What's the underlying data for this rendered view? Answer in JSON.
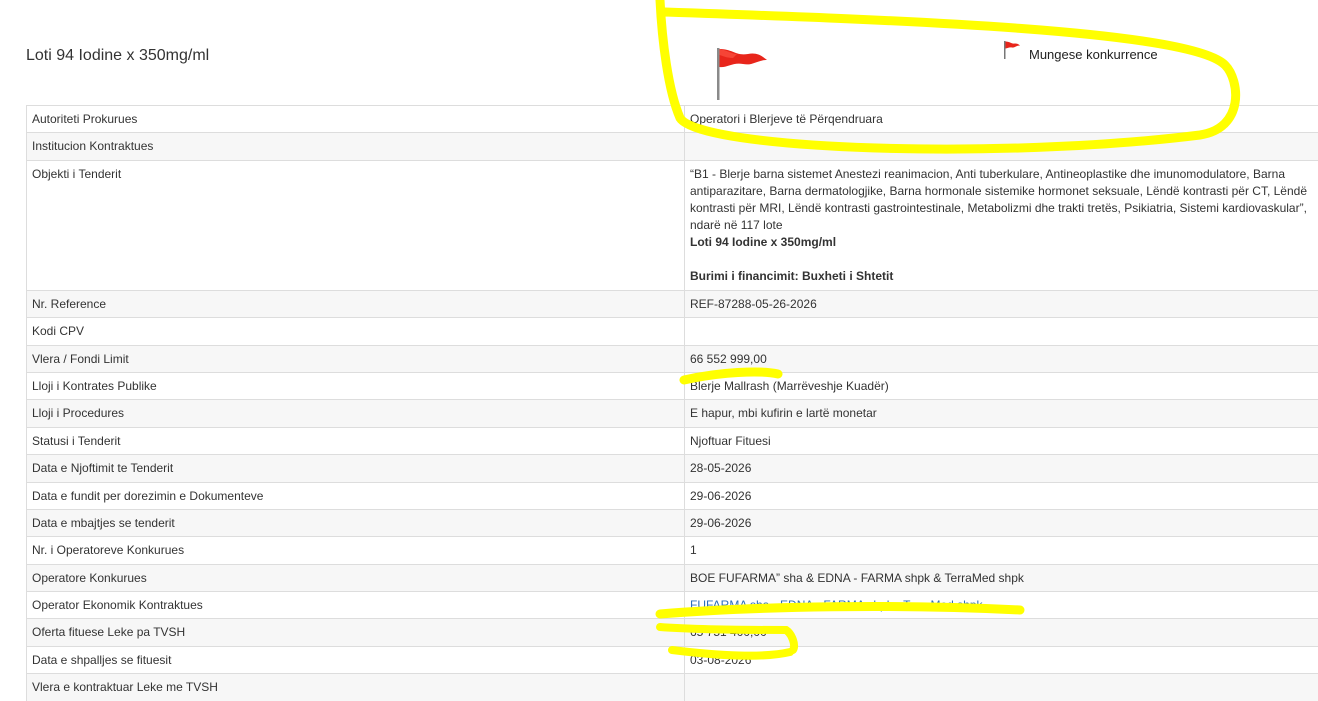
{
  "title": "Loti 94 Iodine x 350mg/ml",
  "legend": {
    "label": "Mungese konkurrence",
    "icon": "red-flag-icon"
  },
  "flag_icon": "red-flag-icon",
  "colors": {
    "flag": "#e8251b",
    "highlight": "#ffff00",
    "link": "#2a6ebb",
    "row_alt": "#f7f7f7",
    "border": "#dddddd"
  },
  "rows": [
    {
      "label": "Autoriteti Prokurues",
      "value": "Operatori i Blerjeve të Përqendruara"
    },
    {
      "label": "Institucion Kontraktues",
      "value": ""
    },
    {
      "label": "Objekti i Tenderit",
      "value": "",
      "desc": {
        "text": "“B1 - Blerje barna sistemet Anestezi reanimacion, Anti tuberkulare, Antineoplastike dhe imunomodulatore, Barna antiparazitare, Barna dermatologjike, Barna hormonale sistemike hormonet seksuale, Lëndë kontrasti për CT, Lëndë kontrasti për MRI, Lëndë kontrasti gastrointestinale, Metabolizmi dhe trakti tretës, Psikiatria, Sistemi kardiovaskular”, ndarë në 117 lote",
        "lot": "Loti 94 Iodine x 350mg/ml",
        "funding": "Burimi i financimit: Buxheti i Shtetit"
      }
    },
    {
      "label": "Nr. Reference",
      "value": "REF-87288-05-26-2026"
    },
    {
      "label": "Kodi CPV",
      "value": ""
    },
    {
      "label": "Vlera / Fondi Limit",
      "value": "66 552 999,00"
    },
    {
      "label": "Lloji i Kontrates Publike",
      "value": "Blerje Mallrash (Marrëveshje Kuadër)"
    },
    {
      "label": "Lloji i Procedures",
      "value": "E hapur, mbi kufirin e lartë monetar"
    },
    {
      "label": "Statusi i Tenderit",
      "value": "Njoftuar Fituesi"
    },
    {
      "label": "Data e Njoftimit te Tenderit",
      "value": "28-05-2026"
    },
    {
      "label": "Data e fundit per dorezimin e Dokumenteve",
      "value": "29-06-2026"
    },
    {
      "label": "Data e mbajtjes se tenderit",
      "value": "29-06-2026"
    },
    {
      "label": "Nr. i Operatoreve Konkurues",
      "value": "1"
    },
    {
      "label": "Operatore Konkurues",
      "value": "BOE FUFARMA” sha & EDNA - FARMA shpk & TerraMed shpk"
    },
    {
      "label": "Operator Ekonomik Kontraktues",
      "value": "FUFARMA sha - EDNA - FARMA shpk - TerraMed shpk",
      "link": true
    },
    {
      "label": "Oferta fituese Leke pa TVSH",
      "value": "65 751 400,00"
    },
    {
      "label": "Data e shpalljes se fituesit",
      "value": "03-08-2026"
    },
    {
      "label": "Vlera e kontraktuar Leke me TVSH",
      "value": ""
    }
  ]
}
